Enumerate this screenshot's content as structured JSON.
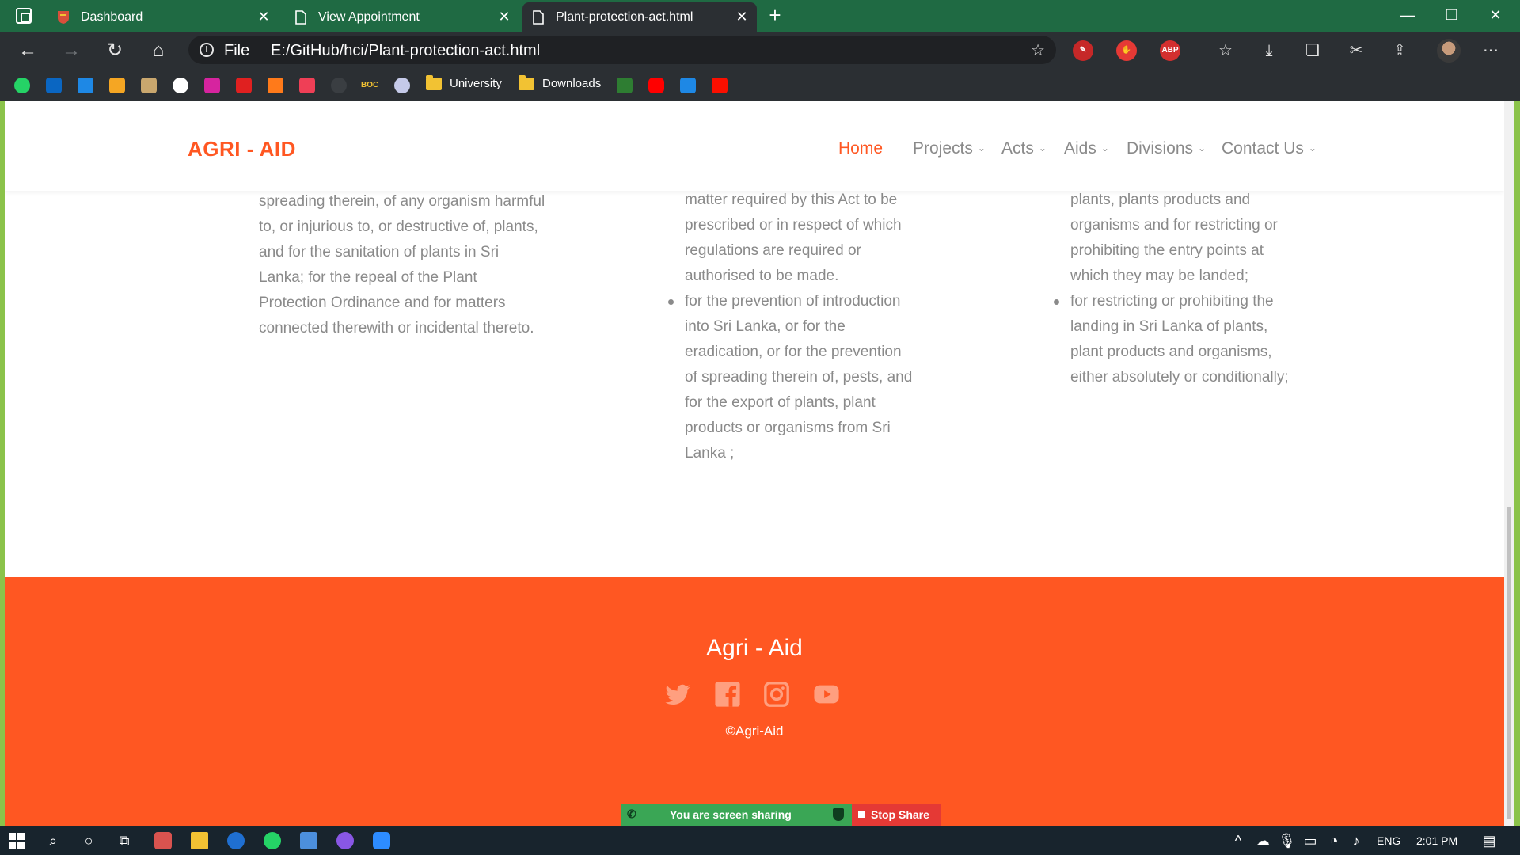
{
  "browser": {
    "tabs": [
      {
        "title": "Dashboard",
        "active": false
      },
      {
        "title": "View Appointment",
        "active": false
      },
      {
        "title": "Plant-protection-act.html",
        "active": true
      }
    ],
    "address": {
      "scheme_label": "File",
      "url": "E:/GitHub/hci/Plant-protection-act.html"
    },
    "extensions": {
      "abp_label": "ABP"
    },
    "bookmarks": {
      "icons": [
        "whatsapp-icon",
        "linkedin-icon",
        "video-icon",
        "film-icon",
        "app-icon",
        "github-icon",
        "instagram-icon",
        "huawei-icon",
        "d-icon",
        "pocket-icon",
        "circle-icon",
        "boc-icon",
        "emblem-icon"
      ],
      "boc_text": "BOC",
      "folders": [
        {
          "label": "University"
        },
        {
          "label": "Downloads"
        }
      ],
      "trailing_icons": [
        "f-icon",
        "youtube-icon",
        "x-icon",
        "adobe-icon"
      ]
    }
  },
  "site": {
    "brand": "AGRI - AID",
    "nav": [
      {
        "label": "Home",
        "active": true,
        "has_caret": false
      },
      {
        "label": "Projects",
        "active": false,
        "has_caret": true
      },
      {
        "label": "Acts",
        "active": false,
        "has_caret": true
      },
      {
        "label": "Aids",
        "active": false,
        "has_caret": true
      },
      {
        "label": "Divisions",
        "active": false,
        "has_caret": true
      },
      {
        "label": "Contact Us",
        "active": false,
        "has_caret": true
      }
    ],
    "columns": {
      "left": [
        "spreading therein, of any organism harmful",
        "to, or injurious to, or destructive of, plants,",
        "and for the sanitation of plants in Sri",
        "Lanka; for the repeal of the Plant",
        "Protection Ordinance and for matters",
        "connected therewith or incidental thereto."
      ],
      "middle_continuation": [
        "matter required by this Act to be",
        "prescribed or in respect of which",
        "regulations are required or",
        "authorised to be made."
      ],
      "middle_bullet": [
        "for the prevention of introduction",
        "into Sri Lanka, or for the",
        "eradication, or for the prevention",
        "of spreading therein of, pests, and",
        "for the export of plants, plant",
        "products or organisms from Sri",
        "Lanka ;"
      ],
      "right_continuation": [
        "plants, plants products and",
        "organisms and for restricting or",
        "prohibiting the entry points at",
        "which they may be landed;"
      ],
      "right_bullet": [
        "for restricting or prohibiting the",
        "landing in Sri Lanka of plants,",
        "plant products and organisms,",
        "either absolutely or conditionally;"
      ]
    },
    "footer": {
      "title": "Agri - Aid",
      "social": [
        "twitter-icon",
        "facebook-icon",
        "instagram-icon",
        "youtube-icon"
      ],
      "copyright": "©Agri-Aid"
    }
  },
  "screen_share": {
    "status": "You are screen sharing",
    "stop_label": "Stop Share"
  },
  "taskbar": {
    "language": "ENG",
    "time": "2:01 PM"
  },
  "colors": {
    "accent": "#ff5722",
    "browser_frame": "#1f6a43",
    "toolbar": "#2b2f33",
    "body_text": "#8a8a8a"
  }
}
